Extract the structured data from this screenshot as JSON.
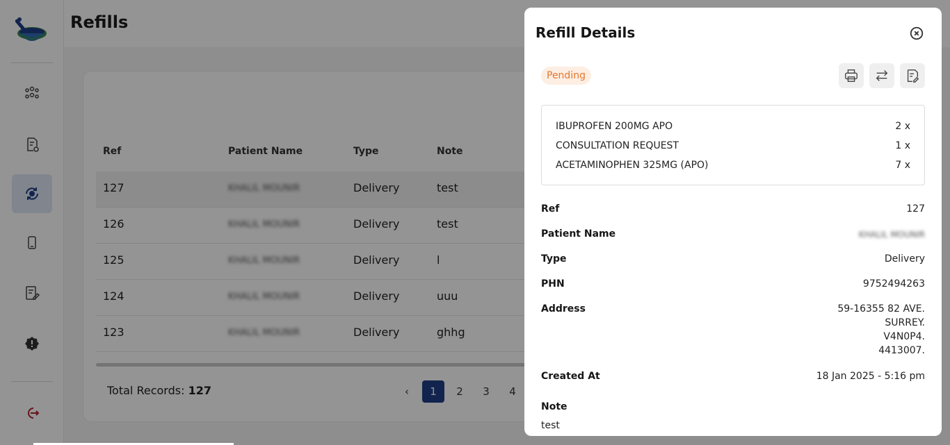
{
  "page": {
    "title": "Refills"
  },
  "sidebar": {
    "logo": "mortar-pestle-logo",
    "items": [
      {
        "icon": "users-group-icon",
        "active": false
      },
      {
        "icon": "prescription-icon",
        "active": false
      },
      {
        "icon": "refill-cycle-icon",
        "active": true
      },
      {
        "icon": "device-icon",
        "active": false
      },
      {
        "icon": "notes-edit-icon",
        "active": false
      },
      {
        "icon": "alert-badge-icon",
        "active": false
      }
    ],
    "logout_icon": "logout-icon"
  },
  "table": {
    "headers": {
      "ref": "Ref",
      "patient": "Patient Name",
      "type": "Type",
      "note": "Note"
    },
    "rows": [
      {
        "ref": "127",
        "patient": "KHALIL MOUNIR",
        "type": "Delivery",
        "note": "test"
      },
      {
        "ref": "126",
        "patient": "KHALIL MOUNIR",
        "type": "Delivery",
        "note": "test"
      },
      {
        "ref": "125",
        "patient": "KHALIL MOUNIR",
        "type": "Delivery",
        "note": "l"
      },
      {
        "ref": "124",
        "patient": "KHALIL MOUNIR",
        "type": "Delivery",
        "note": "uuu"
      },
      {
        "ref": "123",
        "patient": "KHALIL MOUNIR",
        "type": "Delivery",
        "note": "ghhg"
      }
    ],
    "total_label": "Total Records:",
    "total_value": "127",
    "pages": [
      "1",
      "2",
      "3",
      "4"
    ],
    "prev_symbol": "‹"
  },
  "drawer": {
    "title": "Refill Details",
    "status": "Pending",
    "items": [
      {
        "name": "IBUPROFEN 200MG APO",
        "qty": "2 x"
      },
      {
        "name": "CONSULTATION REQUEST",
        "qty": "1 x"
      },
      {
        "name": "ACETAMINOPHEN 325MG (APO)",
        "qty": "7 x"
      }
    ],
    "fields": {
      "ref_label": "Ref",
      "ref_value": "127",
      "patient_label": "Patient Name",
      "patient_value": "KHALIL MOUNIR",
      "type_label": "Type",
      "type_value": "Delivery",
      "phn_label": "PHN",
      "phn_value": "9752494263",
      "address_label": "Address",
      "address_lines": [
        "59-16355 82 AVE.",
        "SURREY.",
        "V4N0P4.",
        "4413007."
      ],
      "created_label": "Created At",
      "created_value": "18 Jan 2025 - 5:16 pm",
      "note_label": "Note",
      "note_value": "test"
    }
  },
  "colors": {
    "accent": "#1f3f87",
    "pending_text": "#e8782e",
    "pending_bg": "#fdeee3",
    "logout": "#b0242f"
  }
}
